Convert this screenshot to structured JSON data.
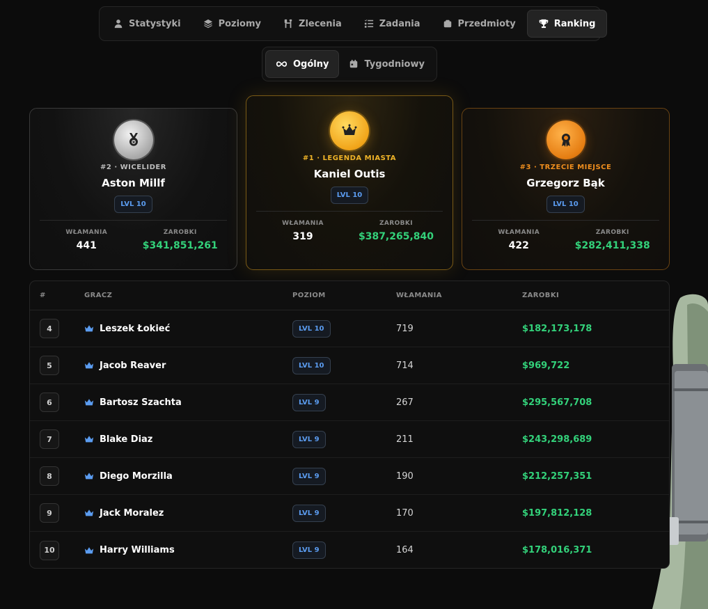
{
  "nav": {
    "tabs": [
      {
        "label": "Statystyki",
        "icon": "user-icon"
      },
      {
        "label": "Poziomy",
        "icon": "layers-icon"
      },
      {
        "label": "Zlecenia",
        "icon": "tools-icon"
      },
      {
        "label": "Zadania",
        "icon": "checklist-icon"
      },
      {
        "label": "Przedmioty",
        "icon": "box-icon"
      },
      {
        "label": "Ranking",
        "icon": "trophy-icon",
        "active": true
      }
    ]
  },
  "subnav": {
    "tabs": [
      {
        "label": "Ogólny",
        "icon": "infinity-icon",
        "active": true
      },
      {
        "label": "Tygodniowy",
        "icon": "calendar-icon"
      }
    ]
  },
  "podium": {
    "second": {
      "rank_label": "#2 · WICELIDER",
      "name": "Aston Millf",
      "level": "LVL 10",
      "breakins_label": "WŁAMANIA",
      "breakins": "441",
      "earnings_label": "ZAROBKI",
      "earnings": "$341,851,261"
    },
    "first": {
      "rank_label": "#1 · LEGENDA MIASTA",
      "name": "Kaniel Outis",
      "level": "LVL 10",
      "breakins_label": "WŁAMANIA",
      "breakins": "319",
      "earnings_label": "ZAROBKI",
      "earnings": "$387,265,840"
    },
    "third": {
      "rank_label": "#3 · TRZECIE MIEJSCE",
      "name": "Grzegorz Bąk",
      "level": "LVL 10",
      "breakins_label": "WŁAMANIA",
      "breakins": "422",
      "earnings_label": "ZAROBKI",
      "earnings": "$282,411,338"
    }
  },
  "table": {
    "headers": {
      "num": "#",
      "player": "GRACZ",
      "level": "POZIOM",
      "breakins": "WŁAMANIA",
      "earnings": "ZAROBKI"
    },
    "rows": [
      {
        "num": "4",
        "name": "Leszek Łokieć",
        "level": "LVL 10",
        "breakins": "719",
        "earnings": "$182,173,178"
      },
      {
        "num": "5",
        "name": "Jacob Reaver",
        "level": "LVL 10",
        "breakins": "714",
        "earnings": "$969,722"
      },
      {
        "num": "6",
        "name": "Bartosz Szachta",
        "level": "LVL 9",
        "breakins": "267",
        "earnings": "$295,567,708"
      },
      {
        "num": "7",
        "name": "Blake Diaz",
        "level": "LVL 9",
        "breakins": "211",
        "earnings": "$243,298,689"
      },
      {
        "num": "8",
        "name": "Diego Morzilla",
        "level": "LVL 9",
        "breakins": "190",
        "earnings": "$212,257,351"
      },
      {
        "num": "9",
        "name": "Jack Moralez",
        "level": "LVL 9",
        "breakins": "170",
        "earnings": "$197,812,128"
      },
      {
        "num": "10",
        "name": "Harry Williams",
        "level": "LVL 9",
        "breakins": "164",
        "earnings": "$178,016,371"
      }
    ]
  },
  "colors": {
    "accent_gold": "#f0b428",
    "accent_bronze": "#ef8e1e",
    "money_green": "#33d17a",
    "level_blue": "#5b9cf0"
  }
}
